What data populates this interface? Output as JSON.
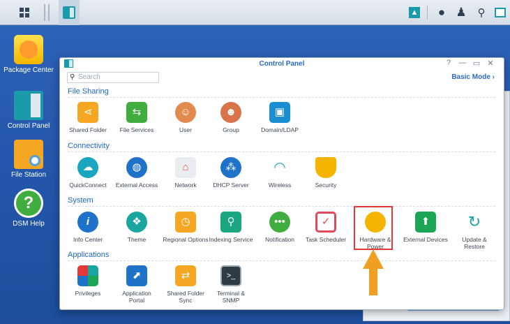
{
  "taskbar": {
    "icons": [
      "apps-grid-icon",
      "control-panel-icon",
      "upload-icon",
      "chat-icon",
      "user-icon",
      "search-icon",
      "widgets-icon"
    ]
  },
  "desktop": {
    "icons": [
      {
        "label": "Package Center"
      },
      {
        "label": "Control Panel"
      },
      {
        "label": "File Station"
      },
      {
        "label": "DSM Help"
      }
    ]
  },
  "window": {
    "title": "Control Panel",
    "search_placeholder": "Search",
    "basic_mode": "Basic Mode"
  },
  "sections": {
    "file_sharing": {
      "title": "File Sharing",
      "items": [
        "Shared Folder",
        "File Services",
        "User",
        "Group",
        "Domain/LDAP"
      ]
    },
    "connectivity": {
      "title": "Connectivity",
      "items": [
        "QuickConnect",
        "External Access",
        "Network",
        "DHCP Server",
        "Wireless",
        "Security"
      ]
    },
    "system": {
      "title": "System",
      "items": [
        "Info Center",
        "Theme",
        "Regional Options",
        "Indexing Service",
        "Notification",
        "Task Scheduler",
        "Hardware & Power",
        "External Devices",
        "Update & Restore"
      ]
    },
    "applications": {
      "title": "Applications",
      "items": [
        "Privileges",
        "Application Portal",
        "Shared Folder Sync",
        "Terminal & SNMP"
      ]
    }
  },
  "background_widget": {
    "axis_value": "0"
  },
  "colors": {
    "highlight": "#e53935",
    "arrow": "#f0a020",
    "accent": "#1f67c2"
  }
}
